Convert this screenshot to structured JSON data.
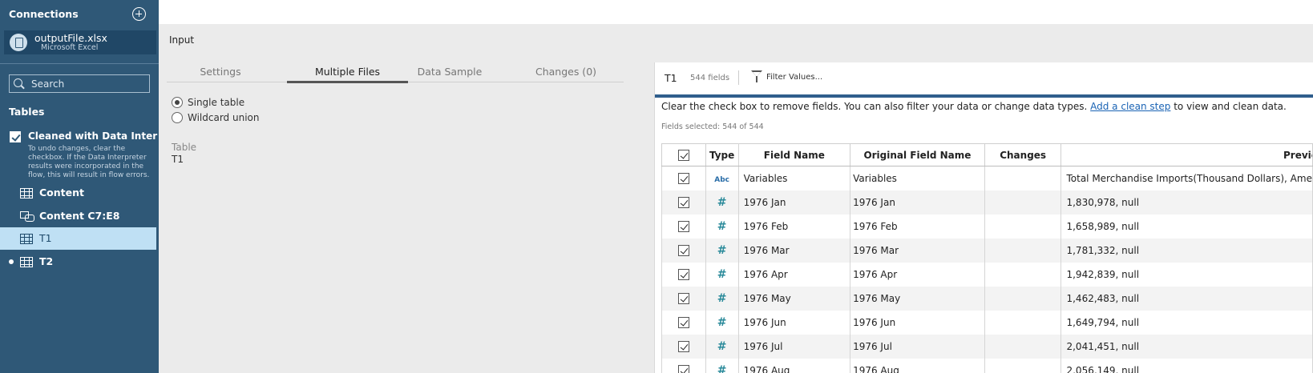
{
  "sidebar": {
    "connections_title": "Connections",
    "connection": {
      "name": "outputFile.xlsx",
      "type": "Microsoft Excel"
    },
    "search_placeholder": "Search",
    "tables_title": "Tables",
    "interpreter": {
      "label": "Cleaned with Data Interpreter",
      "note": "To undo changes, clear the checkbox. If the Data Interpreter results were incorporated in the flow, this will result in flow errors."
    },
    "items": [
      {
        "label": "Content",
        "icon": "table-icon"
      },
      {
        "label": "Content C7:E8",
        "icon": "named-range-icon"
      },
      {
        "label": "T1",
        "icon": "table-icon",
        "selected": true
      },
      {
        "label": "T2",
        "icon": "table-icon",
        "dot": true
      }
    ]
  },
  "input": {
    "title": "Input",
    "tabs": [
      "Settings",
      "Multiple Files",
      "Data Sample",
      "Changes (0)"
    ],
    "active_tab": "Multiple Files",
    "options": [
      {
        "label": "Single table",
        "selected": true
      },
      {
        "label": "Wildcard union",
        "selected": false
      }
    ],
    "table_label": "Table",
    "table_value": "T1"
  },
  "panel": {
    "title": "T1",
    "field_count": "544 fields",
    "filter_label": "Filter Values...",
    "description_before": "Clear the check box to remove fields. You can also filter your data or change data types.",
    "description_link": "Add a clean step",
    "description_after": "to view and clean data.",
    "fields_selected": "Fields selected: 544 of 544",
    "columns": {
      "type": "Type",
      "field_name": "Field Name",
      "original_field_name": "Original Field Name",
      "changes": "Changes",
      "preview": "Preview"
    },
    "rows": [
      {
        "type": "Abc",
        "field": "Variables",
        "original": "Variables",
        "changes": "",
        "preview": "Total Merchandise Imports(Thousand Dollars), Ame"
      },
      {
        "type": "#",
        "field": "1976 Jan",
        "original": "1976 Jan",
        "changes": "",
        "preview": "1,830,978, null"
      },
      {
        "type": "#",
        "field": "1976 Feb",
        "original": "1976 Feb",
        "changes": "",
        "preview": "1,658,989, null"
      },
      {
        "type": "#",
        "field": "1976 Mar",
        "original": "1976 Mar",
        "changes": "",
        "preview": "1,781,332, null"
      },
      {
        "type": "#",
        "field": "1976 Apr",
        "original": "1976 Apr",
        "changes": "",
        "preview": "1,942,839, null"
      },
      {
        "type": "#",
        "field": "1976 May",
        "original": "1976 May",
        "changes": "",
        "preview": "1,462,483, null"
      },
      {
        "type": "#",
        "field": "1976 Jun",
        "original": "1976 Jun",
        "changes": "",
        "preview": "1,649,794, null"
      },
      {
        "type": "#",
        "field": "1976 Jul",
        "original": "1976 Jul",
        "changes": "",
        "preview": "2,041,451, null"
      },
      {
        "type": "#",
        "field": "1976 Aug",
        "original": "1976 Aug",
        "changes": "",
        "preview": "2,056,149, null"
      }
    ]
  },
  "colors": {
    "sidebar": "#2f5877",
    "selected_item": "#bfe0f4",
    "accent_bar": "#2f5e8c",
    "link": "#1a63b4"
  }
}
